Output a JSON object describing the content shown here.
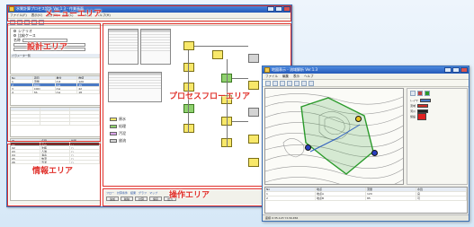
{
  "main_window": {
    "title": "水質計算プロセス設計 Ver.1.3 - 作業画面",
    "menu": [
      "ファイル(F)",
      "表示(V)",
      "設計(D)",
      "計算(C)",
      "ツール(T)",
      "ヘルプ(H)"
    ]
  },
  "labels": {
    "menu_area": "メニューエリア",
    "design_area": "設計エリア",
    "process_flow_area": "プロセスフローエリア",
    "info_area": "情報エリア",
    "operation_area": "操作エリア"
  },
  "left_panel": {
    "radio_a": "シナリオ",
    "radio_b": "比較ケース",
    "field_label": "名称",
    "section_title": "パラメータ一覧",
    "rows": [
      [
        "No",
        "項目",
        "単位",
        "数値"
      ],
      [
        "1",
        "流量",
        "m3",
        "120"
      ],
      [
        "2",
        "BOD",
        "mg",
        "35"
      ],
      [
        "3",
        "COD",
        "mg",
        "42"
      ],
      [
        "4",
        "SS",
        "mg",
        "18"
      ]
    ],
    "info_rows": [
      [
        "ID",
        "名称",
        "状態"
      ],
      [
        "01",
        "原水",
        "○"
      ],
      [
        "02",
        "沈殿",
        "○"
      ],
      [
        "03",
        "ろ過",
        "○"
      ],
      [
        "04",
        "消毒",
        "○"
      ],
      [
        "05",
        "放流",
        "○"
      ],
      [
        "06",
        "汚泥",
        "○"
      ]
    ]
  },
  "flow": {
    "legend": [
      "原水",
      "処理",
      "汚泥",
      "放流"
    ]
  },
  "operation": {
    "tabs": [
      "フロー",
      "計算条件",
      "結果",
      "グラフ",
      "マップ"
    ],
    "buttons": [
      "追加",
      "削除",
      "計算",
      "保存",
      "出力"
    ]
  },
  "map_window": {
    "title": "地図表示 - 流域解析 Ver.1.3",
    "menu": [
      "ファイル",
      "編集",
      "表示",
      "ヘルプ"
    ],
    "side_rows": [
      {
        "label": "レイヤ",
        "color": "#4a79c4"
      },
      {
        "label": "流域",
        "color": "#d0302a"
      },
      {
        "label": "河川",
        "color": "#222222"
      },
      {
        "label": "施設",
        "color": "#e02020"
      }
    ],
    "list_rows": [
      [
        "No",
        "地点",
        "流量",
        "水質"
      ],
      [
        "1",
        "地点A",
        "120",
        "良"
      ],
      [
        "2",
        "地点B",
        "85",
        "可"
      ]
    ],
    "status": "座標 X:35.123 Y:139.456"
  },
  "colors": {
    "accent": "#e0302a",
    "titlebar": "#2459b8",
    "flow_node": "#f8e86a",
    "watershed": "#2a9a2a"
  }
}
